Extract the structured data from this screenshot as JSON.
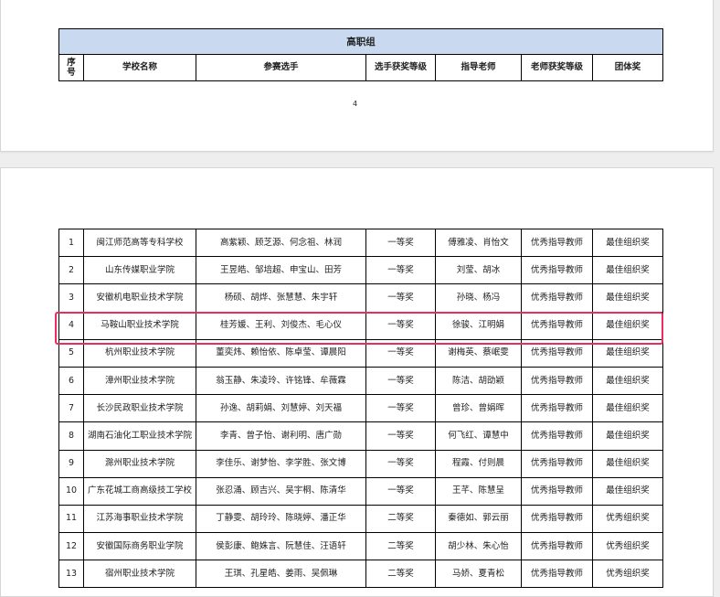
{
  "table": {
    "group_title": "高职组",
    "headers": [
      "序号",
      "学校名称",
      "参赛选手",
      "选手获奖等级",
      "指导老师",
      "老师获奖等级",
      "团体奖"
    ],
    "page_number": "4",
    "rows": [
      {
        "no": "1",
        "school": "闽江师范高等专科学校",
        "players": "高紫颖、顾芝源、何念祖、林润",
        "player_award": "一等奖",
        "teachers": "傅雅凌、肖怡文",
        "teacher_award": "优秀指导教师",
        "team_award": "最佳组织奖"
      },
      {
        "no": "2",
        "school": "山东传媒职业学院",
        "players": "王昱皓、邹培超、申宝山、田芳",
        "player_award": "一等奖",
        "teachers": "刘莹、胡冰",
        "teacher_award": "优秀指导教师",
        "team_award": "最佳组织奖"
      },
      {
        "no": "3",
        "school": "安徽机电职业技术学院",
        "players": "杨硕、胡烨、张慧慧、朱宇轩",
        "player_award": "一等奖",
        "teachers": "孙晓、杨冯",
        "teacher_award": "优秀指导教师",
        "team_award": "最佳组织奖"
      },
      {
        "no": "4",
        "school": "马鞍山职业技术学院",
        "players": "桂芳媛、王利、刘俊杰、毛心仪",
        "player_award": "一等奖",
        "teachers": "徐骏、江明娟",
        "teacher_award": "优秀指导教师",
        "team_award": "最佳组织奖"
      },
      {
        "no": "5",
        "school": "杭州职业技术学院",
        "players": "董奕炜、赖怡依、陈卓莹、谭晨阳",
        "player_award": "一等奖",
        "teachers": "谢梅英、蔡岷雯",
        "teacher_award": "优秀指导教师",
        "team_award": "最佳组织奖"
      },
      {
        "no": "6",
        "school": "漳州职业技术学院",
        "players": "翁玉静、朱凌玲、许铭锋、牟薇霖",
        "player_award": "一等奖",
        "teachers": "陈洁、胡劭颖",
        "teacher_award": "优秀指导教师",
        "team_award": "最佳组织奖"
      },
      {
        "no": "7",
        "school": "长沙民政职业技术学院",
        "players": "孙逸、胡莉娟、刘慧婷、刘天福",
        "player_award": "一等奖",
        "teachers": "曾珍、曾娟晖",
        "teacher_award": "优秀指导教师",
        "team_award": "最佳组织奖"
      },
      {
        "no": "8",
        "school": "湖南石油化工职业技术学院",
        "players": "李青、曾子怡、谢利明、唐广勋",
        "player_award": "一等奖",
        "teachers": "何飞红、谭慧中",
        "teacher_award": "优秀指导教师",
        "team_award": "最佳组织奖"
      },
      {
        "no": "9",
        "school": "滁州职业技术学院",
        "players": "李佳乐、谢梦怡、李学胜、张文博",
        "player_award": "一等奖",
        "teachers": "程霞、付则晨",
        "teacher_award": "优秀指导教师",
        "team_award": "最佳组织奖"
      },
      {
        "no": "10",
        "school": "广东花城工商高级技工学校",
        "players": "张忍涌、顾吉兴、吴宇桐、陈清华",
        "player_award": "一等奖",
        "teachers": "王芊、陈慧呈",
        "teacher_award": "优秀指导教师",
        "team_award": "最佳组织奖"
      },
      {
        "no": "11",
        "school": "江苏海事职业技术学院",
        "players": "丁静雯、胡玲玲、陈晓婷、潘正华",
        "player_award": "二等奖",
        "teachers": "秦德如、郭云丽",
        "teacher_award": "优秀指导教师",
        "team_award": "优秀组织奖"
      },
      {
        "no": "12",
        "school": "安徽国际商务职业学院",
        "players": "侯彭康、鲍姝言、阮慧佳、汪语轩",
        "player_award": "二等奖",
        "teachers": "胡少林、朱心怡",
        "teacher_award": "优秀指导教师",
        "team_award": "优秀组织奖"
      },
      {
        "no": "13",
        "school": "宿州职业技术学院",
        "players": "王琪、孔星皓、姜雨、吴佩琳",
        "player_award": "二等奖",
        "teachers": "马娇、夏青松",
        "teacher_award": "优秀指导教师",
        "team_award": "优秀组织奖"
      }
    ]
  }
}
